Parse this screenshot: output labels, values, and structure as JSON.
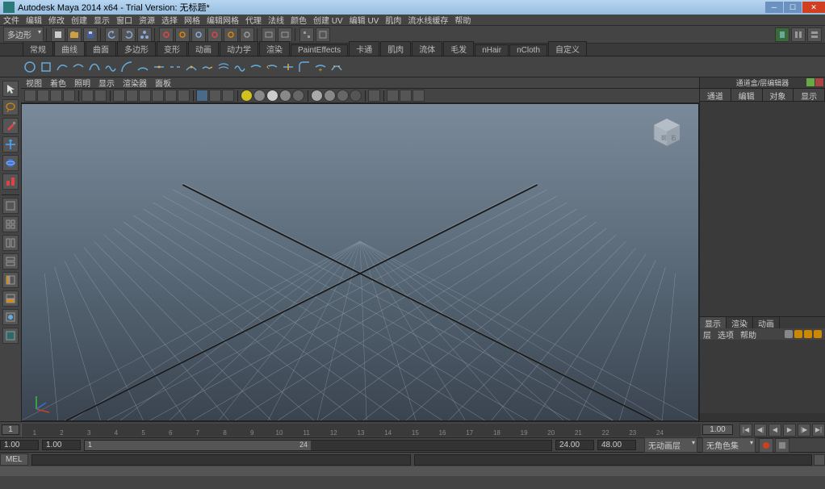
{
  "titlebar": {
    "text": "Autodesk Maya 2014 x64 - Trial Version: 无标题*"
  },
  "menu": [
    "文件",
    "编辑",
    "修改",
    "创建",
    "显示",
    "窗口",
    "资源",
    "选择",
    "网格",
    "编辑网格",
    "代理",
    "法线",
    "颜色",
    "创建 UV",
    "编辑 UV",
    "肌肉",
    "流水线缓存",
    "帮助"
  ],
  "shelf_dropdown": "多边形",
  "shelf_tabs": [
    "常规",
    "曲线",
    "曲面",
    "多边形",
    "变形",
    "动画",
    "动力学",
    "渲染",
    "PaintEffects",
    "卡通",
    "肌肉",
    "流体",
    "毛发",
    "nHair",
    "nCloth",
    "自定义"
  ],
  "shelf_active_tab": 1,
  "panel_menus": [
    "视图",
    "着色",
    "照明",
    "显示",
    "渲染器",
    "面板"
  ],
  "channel_box": {
    "title": "通道盒/层编辑器",
    "tabs": [
      "通道",
      "编辑",
      "对象",
      "显示"
    ]
  },
  "layer_panel": {
    "tabs": [
      "显示",
      "渲染",
      "动画"
    ],
    "options": [
      "层",
      "选项",
      "帮助"
    ]
  },
  "timeline": {
    "start": "1",
    "end": "1.00",
    "frames": [
      1,
      2,
      3,
      4,
      5,
      6,
      7,
      8,
      9,
      10,
      11,
      12,
      13,
      14,
      15,
      16,
      17,
      18,
      19,
      20,
      21,
      22,
      23,
      24
    ]
  },
  "range": {
    "start_outer": "1.00",
    "start_inner": "1.00",
    "handle_start": "1",
    "handle_end": "24",
    "end_inner": "24.00",
    "end_outer": "48.00",
    "anim_label": "无动画层",
    "char_label": "无角色集"
  },
  "cmd": {
    "label": "MEL"
  },
  "colors": {
    "red": "#d04020",
    "green": "#30c040",
    "blue": "#3070d0",
    "yellow": "#d0c020",
    "orange": "#d07020",
    "grey": "#888888",
    "cyan": "#30a0a0"
  }
}
